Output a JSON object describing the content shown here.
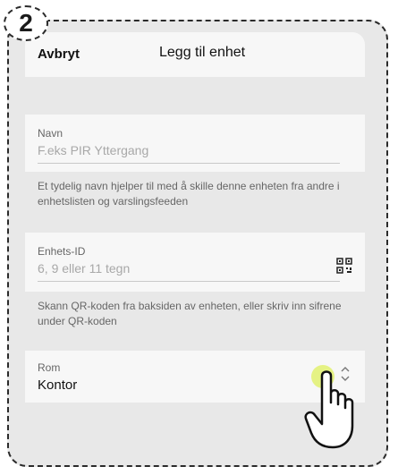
{
  "step": {
    "number": "2"
  },
  "header": {
    "cancel_label": "Avbryt",
    "title": "Legg til enhet"
  },
  "name_field": {
    "label": "Navn",
    "placeholder": "F.eks PIR Yttergang",
    "helper": "Et tydelig navn hjelper til med å skille denne enheten fra andre i enhetslisten og varslingsfeeden"
  },
  "device_id_field": {
    "label": "Enhets-ID",
    "placeholder": "6, 9 eller 11 tegn",
    "helper": "Skann QR-koden fra baksiden av enheten, eller skriv inn sifrene under QR-koden",
    "action_icon": "qr-code-icon"
  },
  "room_field": {
    "label": "Rom",
    "value": "Kontor",
    "action_icon": "chevron-up-down-icon"
  },
  "pointer": {
    "icon": "pointing-hand-icon"
  }
}
